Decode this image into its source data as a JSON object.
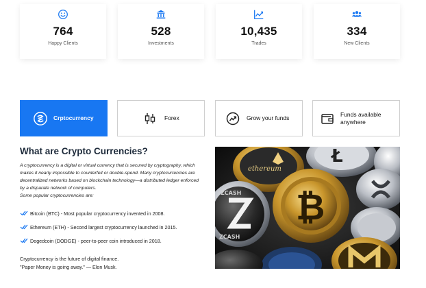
{
  "stats": [
    {
      "icon": "smile-icon",
      "value": "764",
      "label": "Happy Clients"
    },
    {
      "icon": "bank-icon",
      "value": "528",
      "label": "Investments"
    },
    {
      "icon": "chart-icon",
      "value": "10,435",
      "label": "Trades"
    },
    {
      "icon": "users-icon",
      "value": "334",
      "label": "New Clients"
    }
  ],
  "tabs": [
    {
      "label": "Crptocurrency",
      "icon": "crypto-icon",
      "active": true
    },
    {
      "label": "Forex",
      "icon": "candlestick-icon",
      "active": false
    },
    {
      "label": "Grow your funds",
      "icon": "growth-icon",
      "active": false
    },
    {
      "label": "Funds available anywhere",
      "icon": "wallet-icon",
      "active": false
    }
  ],
  "content": {
    "title": "What are Crypto Currencies?",
    "intro": "A cryptocurrency is a digital or virtual currency that is secured by cryptography, which makes it nearly impossible to counterfeit or double-spend. Many cryptocurrencies are decentralized networks based on blockchain technology—a distributed ledger enforced by a disparate network of computers.",
    "subheading": "Some popular cryptocurrencies are:",
    "list": [
      "Bitcoin (BTC) - Most popular cryptocurrency invented in 2008.",
      "Ethereum (ETH) - Second largest cryptocurrency launched in 2015.",
      "Dogedcoin (DODGE) - peer-to-peer coin introduced in 2018."
    ],
    "outro_line1": "Cryptocurrency is the future of digital finance.",
    "outro_line2": "\"Paper Money is going away.\" — Elon Musk."
  },
  "image": {
    "coin_texts": [
      "ethereum",
      "ZCASH",
      "ZCASH"
    ]
  },
  "colors": {
    "accent": "#1877f2",
    "text": "#222222",
    "title": "#1d2a3a"
  }
}
